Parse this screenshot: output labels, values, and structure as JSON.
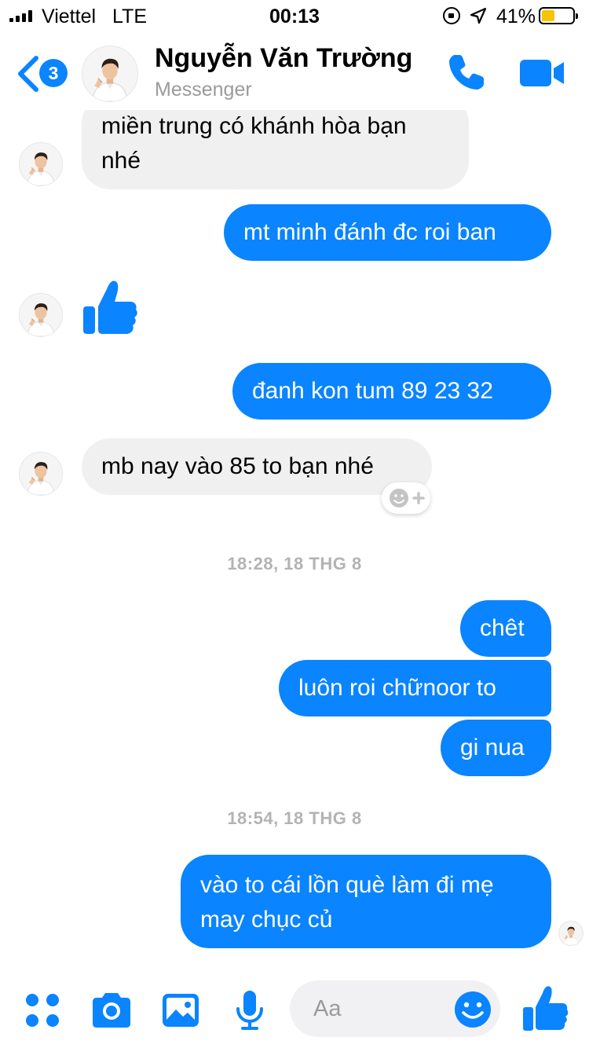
{
  "status_bar": {
    "carrier": "Viettel",
    "network": "LTE",
    "time": "00:13",
    "battery_percent": "41%",
    "battery_level": 0.41,
    "icons": [
      "signal-bars-icon",
      "orientation-lock-icon",
      "location-arrow-icon",
      "battery-icon"
    ]
  },
  "header": {
    "unread_count": "3",
    "contact_name": "Nguyễn Văn Trường",
    "subtitle": "Messenger",
    "icons": [
      "back-chevron-icon",
      "phone-icon",
      "video-camera-icon"
    ]
  },
  "messages": [
    {
      "side": "in",
      "lines": [
        "miền trung có khánh hòa bạn",
        "nhé"
      ]
    },
    {
      "side": "out",
      "text": "mt minh đánh đc roi ban"
    },
    {
      "side": "in",
      "type": "like",
      "icon": "thumbs-up-icon"
    },
    {
      "side": "out",
      "text": "đanh kon tum 89 23 32"
    },
    {
      "side": "in",
      "text": "mb nay vào 85 to bạn nhé"
    },
    {
      "type": "timestamp",
      "text": "18:28, 18 THG 8"
    },
    {
      "side": "out",
      "text": "chêt"
    },
    {
      "side": "out",
      "text": "luôn roi  chữnoor to"
    },
    {
      "side": "out",
      "text": "gi nua"
    },
    {
      "type": "timestamp",
      "text": "18:54, 18 THG 8"
    },
    {
      "side": "out",
      "lines": [
        "vào to cái lồn què làm đi mẹ",
        "may chục củ"
      ]
    }
  ],
  "composer": {
    "placeholder": "Aa",
    "icons": [
      "more-apps-icon",
      "camera-icon",
      "photo-icon",
      "microphone-icon",
      "emoji-icon",
      "thumbs-up-icon"
    ]
  },
  "colors": {
    "accent": "#0a84ff",
    "incoming_bubble": "#f0f0f0",
    "timestamp": "#b3b3b3",
    "battery_fill": "#f6c400"
  }
}
